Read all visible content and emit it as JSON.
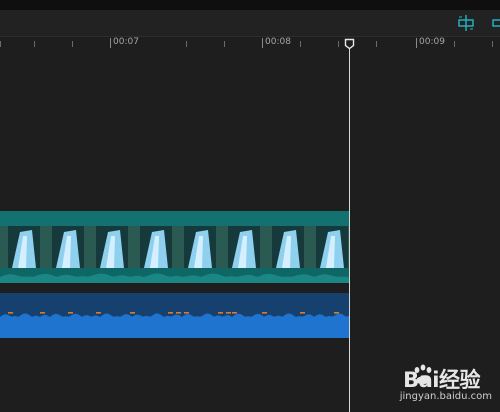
{
  "toolbar": {
    "icons": [
      "split-icon",
      "link-icon"
    ],
    "accent": "#25b6c8"
  },
  "ruler": {
    "labels": [
      "00:07",
      "00:08",
      "00:09"
    ]
  },
  "timeline": {
    "video_clip_color": "#0e5e5c",
    "audio_clip_color": "#16416f",
    "audio_wave_color": "#1f74cf",
    "audio_peak_color": "#e0782c",
    "playhead_color": "#d9d9d9"
  },
  "watermark": {
    "brand": "Bai经验",
    "url": "jingyan.baidu.com"
  }
}
